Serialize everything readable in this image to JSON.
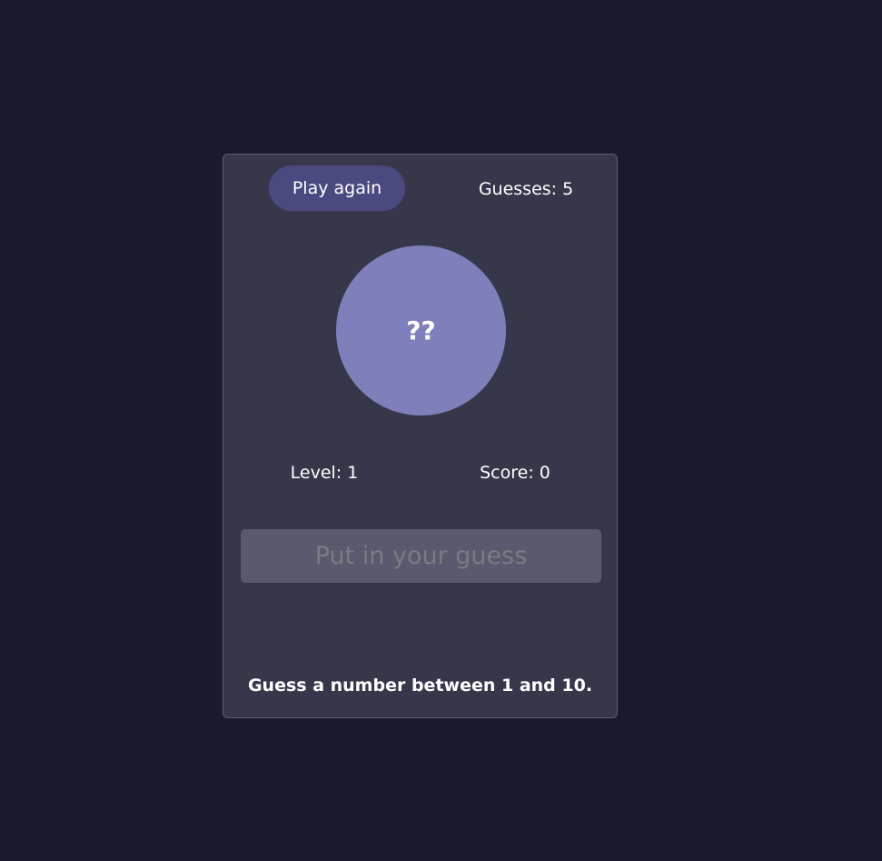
{
  "header": {
    "play_again_label": "Play again",
    "guesses_text": "Guesses: 5"
  },
  "display": {
    "hidden_number": "??"
  },
  "stats": {
    "level_text": "Level: 1",
    "score_text": "Score: 0"
  },
  "input": {
    "placeholder": "Put in your guess",
    "value": ""
  },
  "message": "Guess a number between 1 and 10.",
  "colors": {
    "background": "#1b1b2d",
    "card": "#37374b",
    "button": "#4a4a80",
    "circle": "#7f7fbb",
    "input": "#5a5a6e"
  }
}
